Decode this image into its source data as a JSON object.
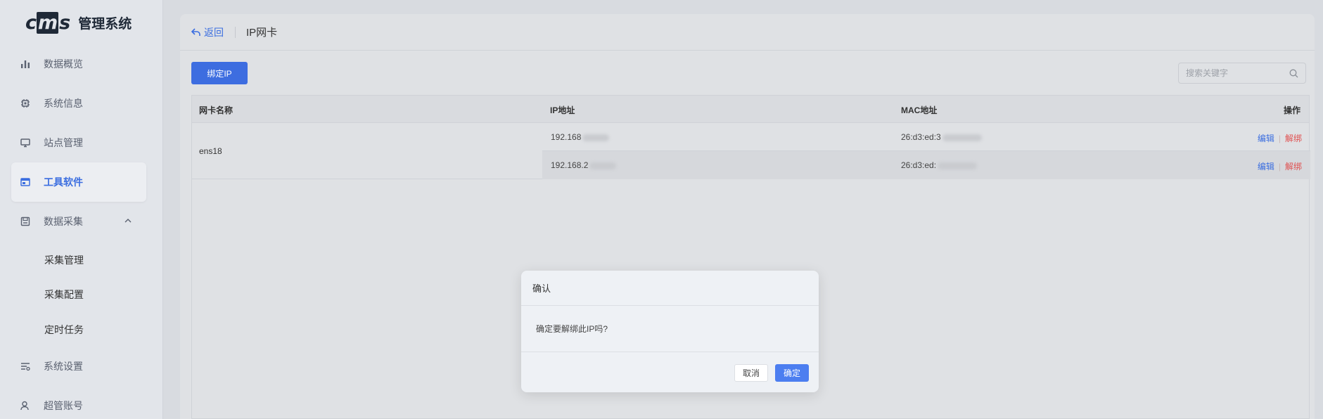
{
  "app": {
    "logo_text": "管理系统"
  },
  "sidebar": {
    "items": [
      {
        "label": "数据概览",
        "icon": "bar-chart-icon"
      },
      {
        "label": "系统信息",
        "icon": "chip-icon"
      },
      {
        "label": "站点管理",
        "icon": "monitor-icon"
      },
      {
        "label": "工具软件",
        "icon": "window-icon",
        "active": true
      },
      {
        "label": "数据采集",
        "icon": "save-icon",
        "expanded": true
      },
      {
        "label": "系统设置",
        "icon": "sliders-icon"
      },
      {
        "label": "超管账号",
        "icon": "user-icon"
      }
    ],
    "sub_items": [
      "采集管理",
      "采集配置",
      "定时任务"
    ]
  },
  "header": {
    "back_label": "返回",
    "title": "IP网卡"
  },
  "toolbar": {
    "bind_ip_label": "绑定IP",
    "search_placeholder": "搜索关键字"
  },
  "table": {
    "columns": [
      "网卡名称",
      "IP地址",
      "MAC地址",
      "操作"
    ],
    "rows": [
      {
        "name": "ens18",
        "entries": [
          {
            "ip": "192.168",
            "mac": "26:d3:ed:3"
          },
          {
            "ip": "192.168.2",
            "mac": "26:d3:ed:"
          }
        ]
      }
    ],
    "actions": {
      "edit": "编辑",
      "unbind": "解绑"
    }
  },
  "dialog": {
    "title": "确认",
    "message": "确定要解绑此IP吗?",
    "cancel_label": "取消",
    "ok_label": "确定"
  },
  "colors": {
    "accent": "#3d6de0",
    "danger": "#e05050"
  }
}
